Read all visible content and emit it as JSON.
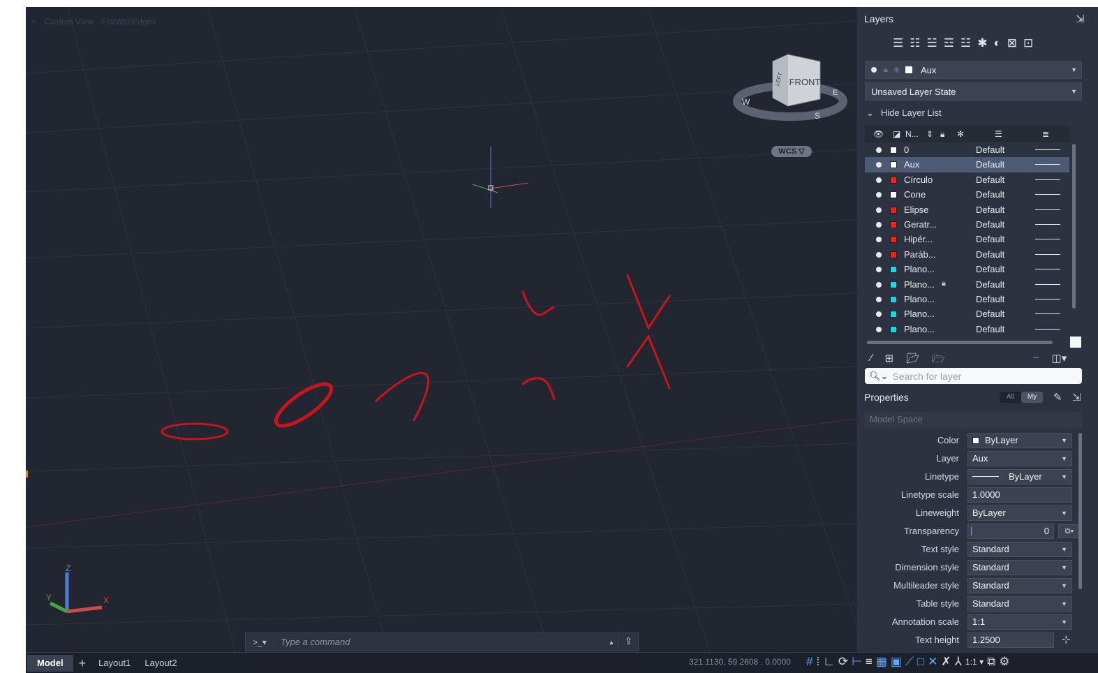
{
  "viewport": {
    "view_name": "Custom View",
    "visual_style": "FlatWithEdges",
    "viewcube_face": "FRONT",
    "viewcube_left_face": "LEFT",
    "compass": {
      "w": "W",
      "s": "S",
      "e": "E"
    },
    "wcs_label": "WCS",
    "ucs": {
      "x": "X",
      "y": "Y",
      "z": "Z"
    },
    "curve_color": "#c8141c"
  },
  "command": {
    "prompt": ">_▾",
    "placeholder": "Type a command",
    "caret": "▲",
    "share_icon": "share-icon"
  },
  "statusbar": {
    "tabs": [
      "Model",
      "+",
      "Layout1",
      "Layout2"
    ],
    "coords": "321.1130, 59.2608 , 0.0000",
    "scale": "1:1 ▾"
  },
  "layers": {
    "title": "Layers",
    "current_layer": "Aux",
    "layer_state": "Unsaved Layer State",
    "hide_list_label": "Hide Layer List",
    "col_name": "N...",
    "rows": [
      {
        "name": "0",
        "color": "#ffffff",
        "linetype": "Default",
        "locked": false,
        "selected": false
      },
      {
        "name": "Aux",
        "color": "#ffffff",
        "linetype": "Default",
        "locked": false,
        "selected": true
      },
      {
        "name": "Círculo",
        "color": "#e8261c",
        "linetype": "Default",
        "locked": false,
        "selected": false
      },
      {
        "name": "Cone",
        "color": "#ffffff",
        "linetype": "Default",
        "locked": false,
        "selected": false
      },
      {
        "name": "Elipse",
        "color": "#e8261c",
        "linetype": "Default",
        "locked": false,
        "selected": false
      },
      {
        "name": "Geratr...",
        "color": "#e8261c",
        "linetype": "Default",
        "locked": false,
        "selected": false
      },
      {
        "name": "Hipér...",
        "color": "#e8261c",
        "linetype": "Default",
        "locked": false,
        "selected": false
      },
      {
        "name": "Paráb...",
        "color": "#e8261c",
        "linetype": "Default",
        "locked": false,
        "selected": false
      },
      {
        "name": "Plano...",
        "color": "#17d6e6",
        "linetype": "Default",
        "locked": false,
        "selected": false
      },
      {
        "name": "Plano...",
        "color": "#17d6e6",
        "linetype": "Default",
        "locked": true,
        "selected": false
      },
      {
        "name": "Plano...",
        "color": "#17d6e6",
        "linetype": "Default",
        "locked": false,
        "selected": false
      },
      {
        "name": "Plano...",
        "color": "#17d6e6",
        "linetype": "Default",
        "locked": false,
        "selected": false
      },
      {
        "name": "Plano...",
        "color": "#17d6e6",
        "linetype": "Default",
        "locked": false,
        "selected": false
      }
    ],
    "search_placeholder": "Search for layer"
  },
  "properties": {
    "title": "Properties",
    "filter_all": "All",
    "filter_my": "My",
    "space": "Model Space",
    "rows": [
      {
        "label": "Color",
        "value": "ByLayer",
        "kind": "swatch"
      },
      {
        "label": "Layer",
        "value": "Aux",
        "kind": "dropdown"
      },
      {
        "label": "Linetype",
        "value": "ByLayer",
        "kind": "linetype"
      },
      {
        "label": "Linetype scale",
        "value": "1.0000",
        "kind": "text"
      },
      {
        "label": "Lineweight",
        "value": "ByLayer",
        "kind": "dropdown"
      },
      {
        "label": "Transparency",
        "value": "0",
        "kind": "slider"
      },
      {
        "label": "Text style",
        "value": "Standard",
        "kind": "dropdown"
      },
      {
        "label": "Dimension style",
        "value": "Standard",
        "kind": "dropdown"
      },
      {
        "label": "Multileader style",
        "value": "Standard",
        "kind": "dropdown"
      },
      {
        "label": "Table style",
        "value": "Standard",
        "kind": "dropdown"
      },
      {
        "label": "Annotation scale",
        "value": "1:1",
        "kind": "dropdown"
      },
      {
        "label": "Text height",
        "value": "1.2500",
        "kind": "text"
      }
    ]
  }
}
